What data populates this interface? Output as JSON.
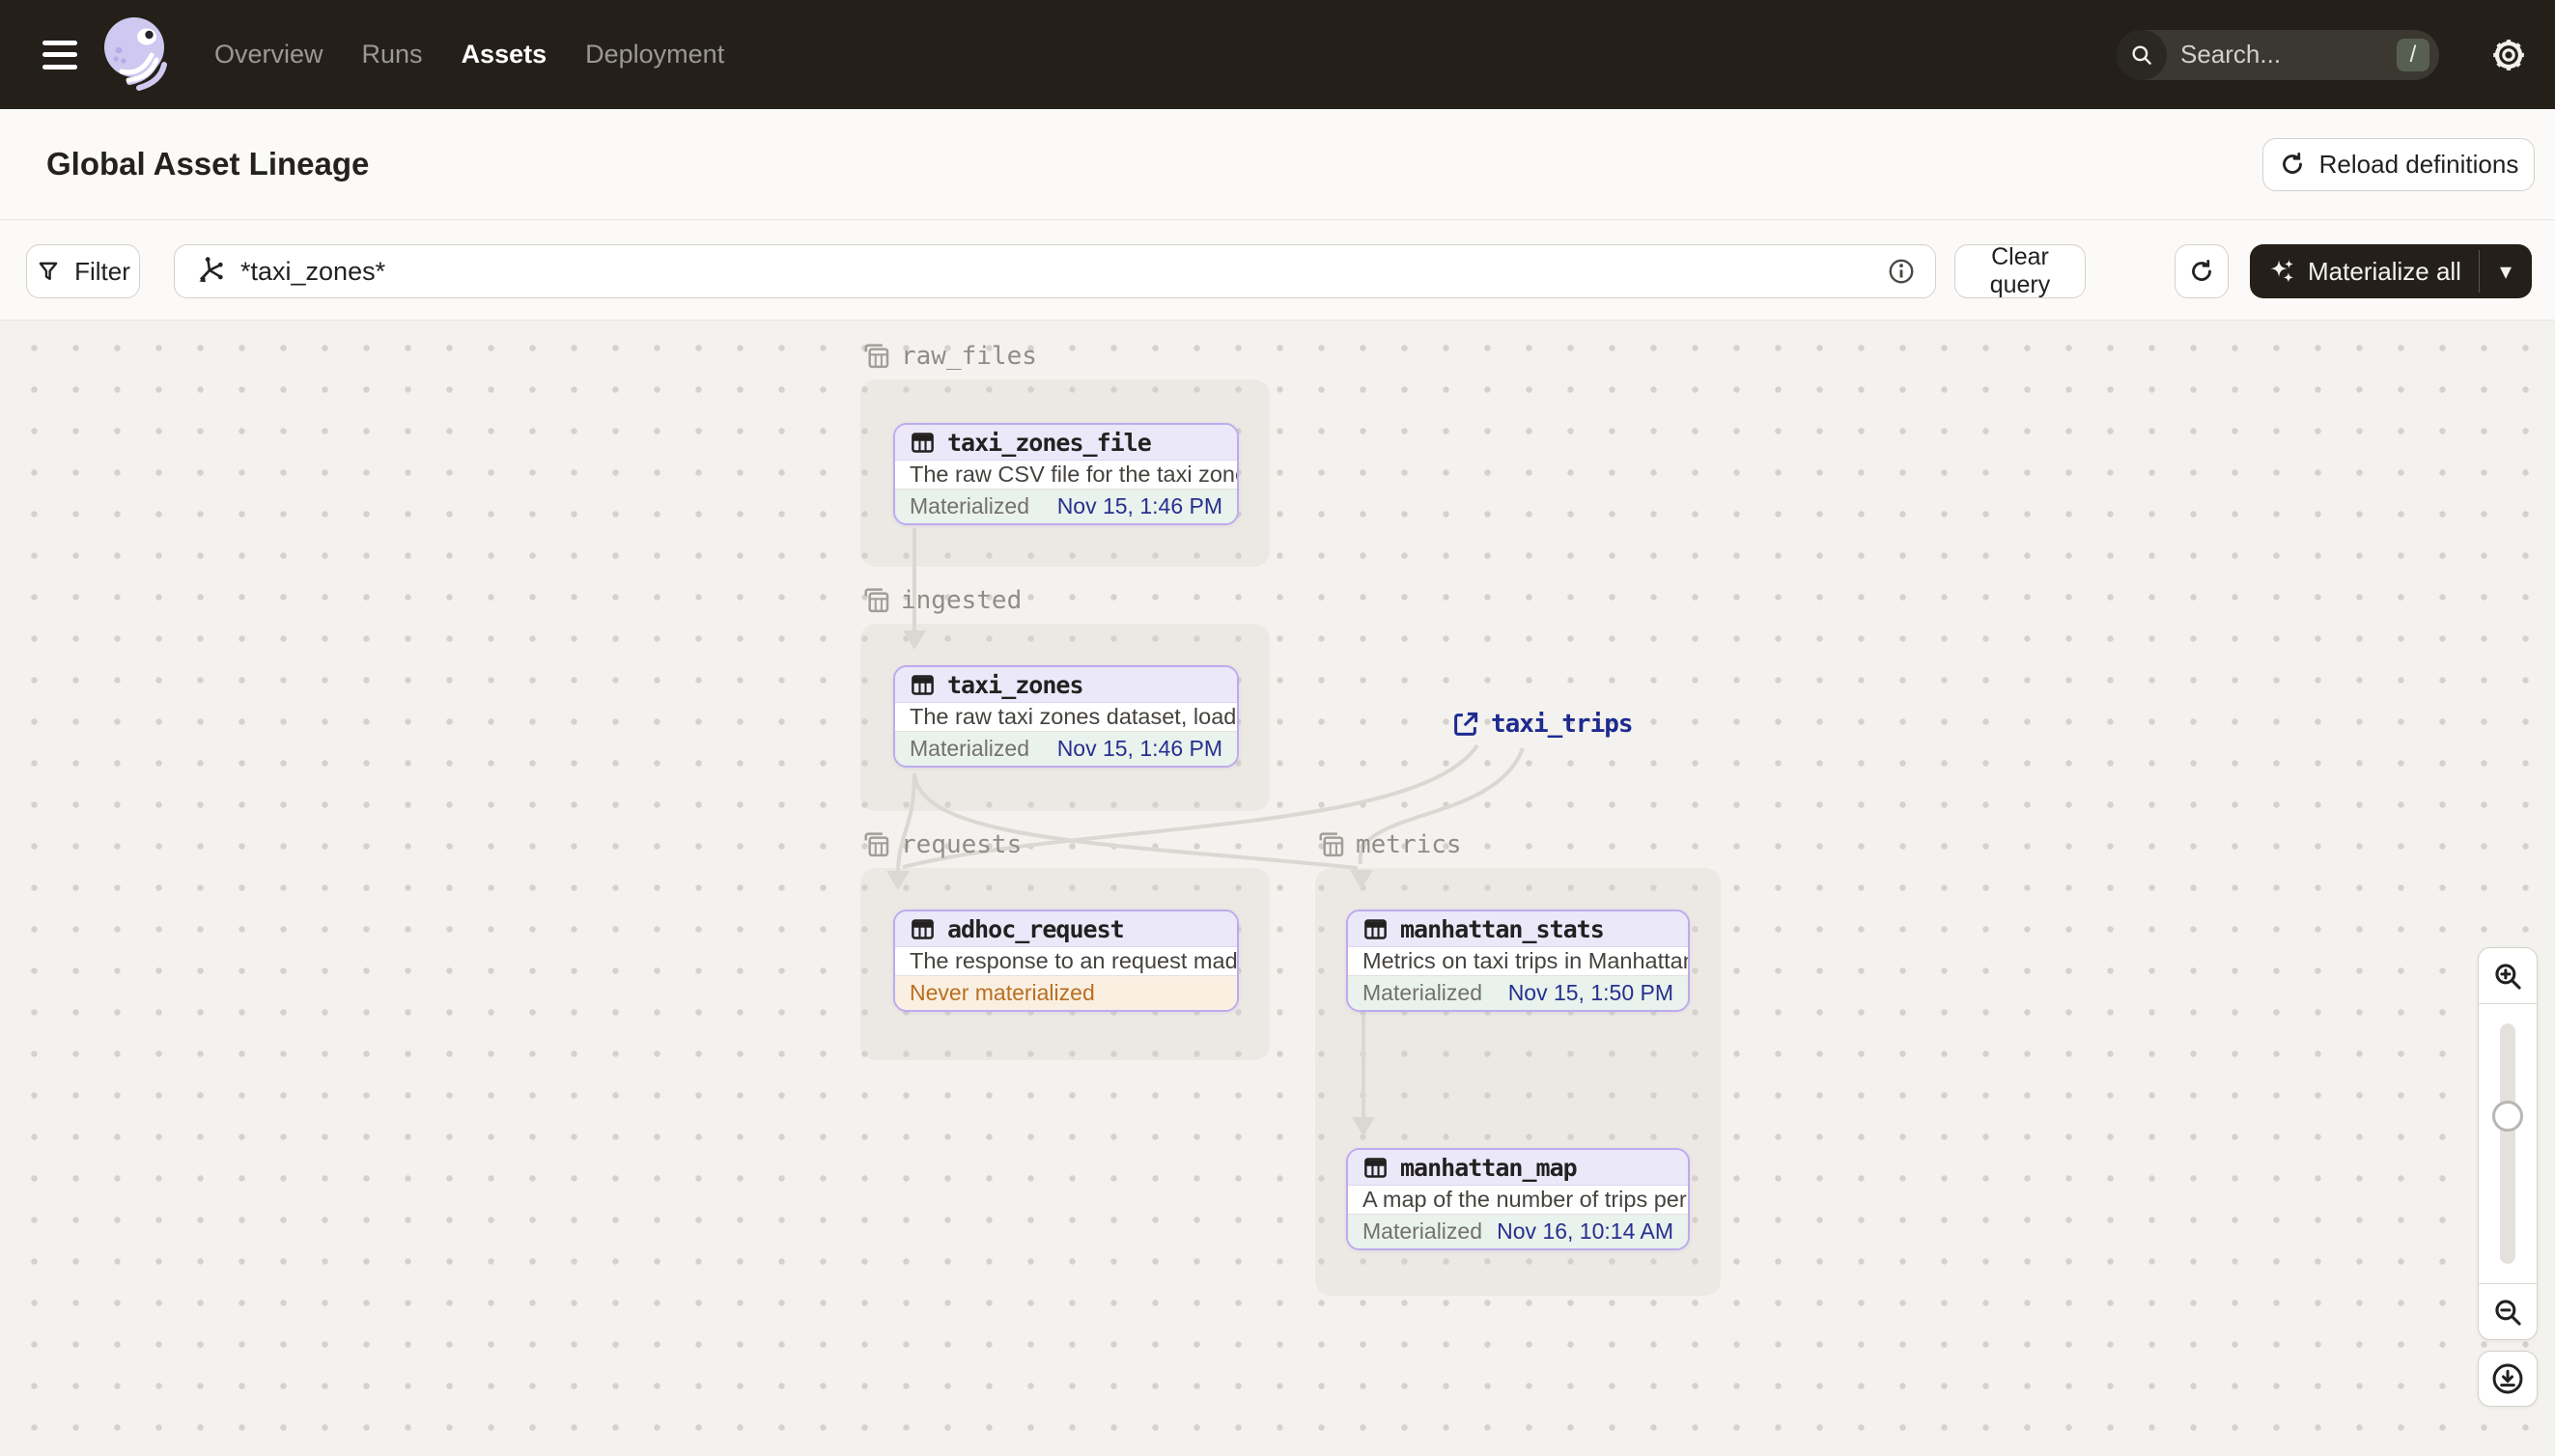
{
  "topbar": {
    "nav": [
      {
        "label": "Overview",
        "active": false
      },
      {
        "label": "Runs",
        "active": false
      },
      {
        "label": "Assets",
        "active": true
      },
      {
        "label": "Deployment",
        "active": false
      }
    ],
    "search": {
      "placeholder": "Search...",
      "shortcut": "/"
    }
  },
  "header": {
    "title": "Global Asset Lineage",
    "reload_label": "Reload definitions"
  },
  "toolbar": {
    "filter_label": "Filter",
    "query_value": "*taxi_zones*",
    "clear_label": "Clear query",
    "materialize_label": "Materialize all"
  },
  "graph": {
    "groups": [
      {
        "name": "raw_files"
      },
      {
        "name": "ingested"
      },
      {
        "name": "requests"
      },
      {
        "name": "metrics"
      }
    ],
    "nodes": [
      {
        "title": "taxi_zones_file",
        "group": "raw_files",
        "description": "The raw CSV file for the taxi zones dat...",
        "status": "Materialized",
        "timestamp": "Nov 15, 1:46 PM"
      },
      {
        "title": "taxi_zones",
        "group": "ingested",
        "description": "The raw taxi zones dataset, loaded int...",
        "status": "Materialized",
        "timestamp": "Nov 15, 1:46 PM"
      },
      {
        "title": "adhoc_request",
        "group": "requests",
        "description": "The response to an request made in th...",
        "status": "Never materialized",
        "timestamp": ""
      },
      {
        "title": "manhattan_stats",
        "group": "metrics",
        "description": "Metrics on taxi trips in Manhattan",
        "status": "Materialized",
        "timestamp": "Nov 15, 1:50 PM"
      },
      {
        "title": "manhattan_map",
        "group": "metrics",
        "description": "A map of the number of trips per taxi z...",
        "status": "Materialized",
        "timestamp": "Nov 16, 10:14 AM"
      }
    ],
    "external_asset": {
      "label": "taxi_trips"
    }
  },
  "icons": [
    "menu-icon",
    "dagster-logo",
    "search-icon",
    "settings-gear-icon",
    "refresh-icon",
    "filter-funnel-icon",
    "asset-graph-query-icon",
    "info-icon",
    "sparkle-icon",
    "caret-down-icon",
    "table-asset-icon",
    "group-tables-icon",
    "external-link-icon",
    "zoom-in-icon",
    "zoom-out-icon",
    "download-icon"
  ],
  "colors": {
    "topbar_bg": "#242019",
    "node_border_purple": "#BDABEE",
    "node_header_bg": "#EBE8FA",
    "materialized_bg": "#E9F2EC",
    "never_materialized_bg": "#FAF0E2",
    "never_materialized_text": "#BA6E1F",
    "timestamp_text": "#27308F",
    "external_link_text": "#1D2B8F",
    "edge": "#DBD7D2",
    "canvas_bg": "#F4F2EF"
  }
}
